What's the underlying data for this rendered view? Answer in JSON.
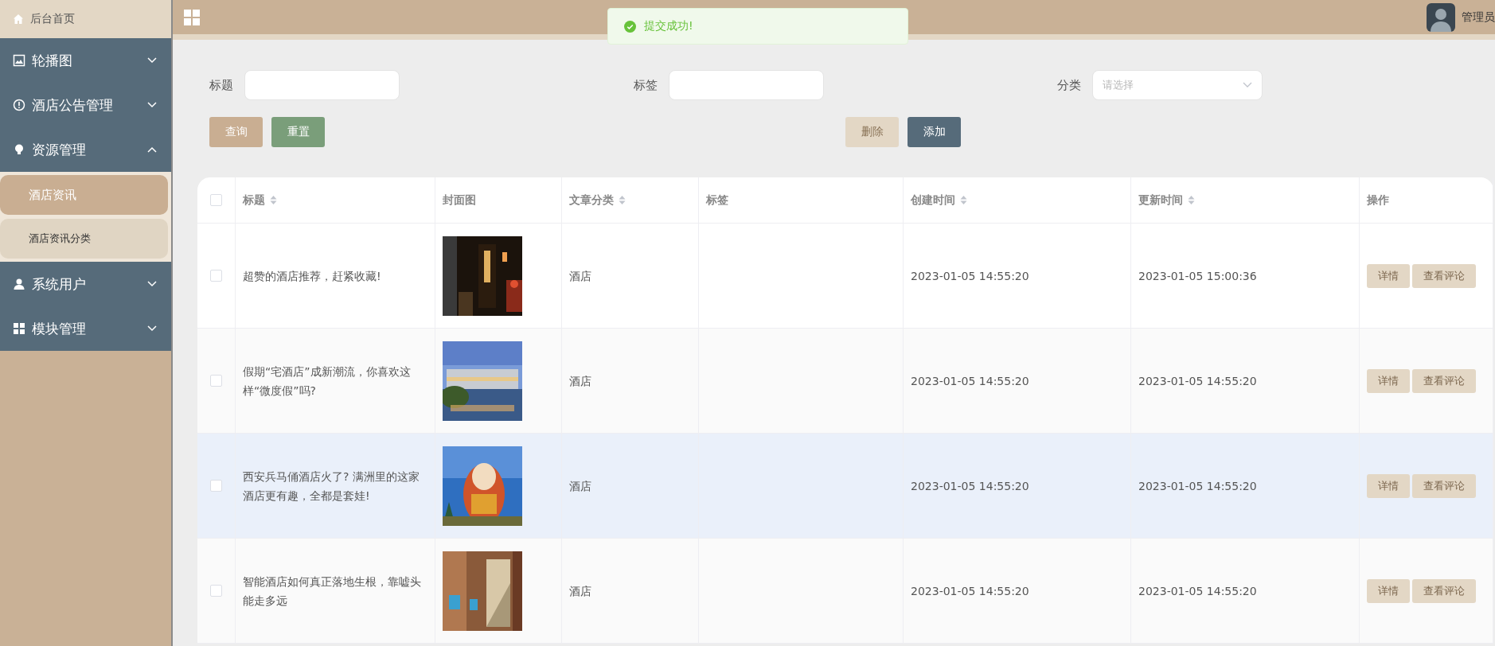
{
  "sidebar": {
    "home": {
      "label": "后台首页"
    },
    "items": [
      {
        "label": "轮播图",
        "expanded": false
      },
      {
        "label": "酒店公告管理",
        "expanded": false
      },
      {
        "label": "资源管理",
        "expanded": true,
        "children": [
          {
            "label": "酒店资讯",
            "selected": true
          },
          {
            "label": "酒店资讯分类",
            "selected": false
          }
        ]
      },
      {
        "label": "系统用户",
        "expanded": false
      },
      {
        "label": "模块管理",
        "expanded": false
      }
    ]
  },
  "header": {
    "user": "管理员"
  },
  "toast": {
    "text": "提交成功!"
  },
  "filters": [
    {
      "label": "标题",
      "kind": "input"
    },
    {
      "label": "标签",
      "kind": "input"
    },
    {
      "label": "分类",
      "kind": "select",
      "placeholder": "请选择"
    }
  ],
  "buttons": [
    {
      "label": "查询",
      "kind": "query"
    },
    {
      "label": "重置",
      "kind": "reset"
    },
    {
      "label": "删除",
      "kind": "delete",
      "disabled": true
    },
    {
      "label": "添加",
      "kind": "add"
    }
  ],
  "table": {
    "all_checked": false,
    "columns": [
      {
        "label": "标题",
        "sortable": true
      },
      {
        "label": "封面图",
        "sortable": false
      },
      {
        "label": "文章分类",
        "sortable": true
      },
      {
        "label": "标签",
        "sortable": false
      },
      {
        "label": "创建时间",
        "sortable": true
      },
      {
        "label": "更新时间",
        "sortable": true
      },
      {
        "label": "操作",
        "sortable": false
      }
    ],
    "rows": [
      {
        "checked": false,
        "hovered": false,
        "title": "超赞的酒店推荐，赶紧收藏!",
        "cover": {
          "kind": "picture"
        },
        "category": "酒店",
        "created": "2023-01-05 14:55:20",
        "updated": "2023-01-05 15:00:36",
        "actions": [
          "详情",
          "查看评论"
        ]
      },
      {
        "checked": false,
        "hovered": false,
        "title": "假期“宅酒店”成新潮流，你喜欢这样“微度假”吗?",
        "cover": {
          "kind": "picture"
        },
        "category": "酒店",
        "created": "2023-01-05 14:55:20",
        "updated": "2023-01-05 14:55:20",
        "actions": [
          "详情",
          "查看评论"
        ]
      },
      {
        "checked": false,
        "hovered": true,
        "title": "西安兵马俑酒店火了? 满洲里的这家酒店更有趣，全都是套娃!",
        "cover": {
          "kind": "picture"
        },
        "category": "酒店",
        "created": "2023-01-05 14:55:20",
        "updated": "2023-01-05 14:55:20",
        "actions": [
          "详情",
          "查看评论"
        ]
      },
      {
        "checked": false,
        "hovered": false,
        "title": "智能酒店如何真正落地生根，靠嘘头能走多远",
        "cover": {
          "kind": "picture"
        },
        "category": "酒店",
        "created": "2023-01-05 14:55:20",
        "updated": "2023-01-05 14:55:20",
        "actions": [
          "详情",
          "查看评论"
        ]
      }
    ]
  }
}
